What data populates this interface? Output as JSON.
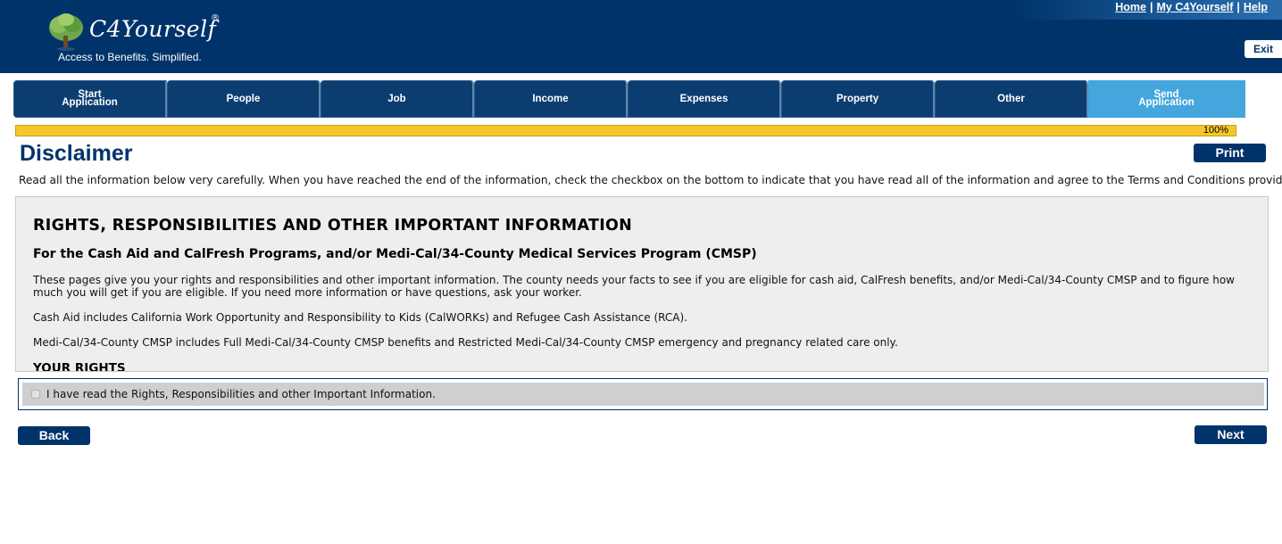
{
  "header": {
    "logo_text": "C4Yourself",
    "logo_registered": "®",
    "tagline": "Access to Benefits.  Simplified.",
    "links": [
      "Home",
      "My C4Yourself",
      "Help"
    ],
    "link_separator": "|",
    "exit_label": "Exit",
    "logo_icon": "tree-icon"
  },
  "steps": [
    {
      "label": "Start\nApplication",
      "active": false
    },
    {
      "label": "People",
      "active": false
    },
    {
      "label": "Job",
      "active": false
    },
    {
      "label": "Income",
      "active": false
    },
    {
      "label": "Expenses",
      "active": false
    },
    {
      "label": "Property",
      "active": false
    },
    {
      "label": "Other",
      "active": false
    },
    {
      "label": "Send\nApplication",
      "active": true
    }
  ],
  "progress": {
    "value": 1.0,
    "label": "100%"
  },
  "page": {
    "title": "Disclaimer",
    "print_label": "Print",
    "instructions": "Read all the information below very carefully. When you have reached the end of the information, check the checkbox on the bottom to indicate that you have read all of the information and agree to the Terms and Conditions provided."
  },
  "info": {
    "heading": "RIGHTS, RESPONSIBILITIES AND OTHER IMPORTANT INFORMATION",
    "subheading": "For the Cash Aid and CalFresh Programs, and/or Medi-Cal/34-County Medical Services Program (CMSP)",
    "para1": "These pages give you your rights and responsibilities and other important information. The county needs your facts to see if you are eligible for cash aid, CalFresh benefits, and/or Medi-Cal/34-County CMSP and to figure how much you will get if you are eligible. If you need more information or have questions, ask your worker.",
    "para2": "Cash Aid includes California Work Opportunity and Responsibility to Kids (CalWORKs) and Refugee Cash Assistance (RCA).",
    "para3": "Medi-Cal/34-County CMSP includes Full Medi-Cal/34-County CMSP benefits and Restricted Medi-Cal/34-County CMSP emergency and pregnancy related care only.",
    "rights_heading": "YOUR RIGHTS"
  },
  "agree": {
    "label": "I have read the Rights, Responsibilities and other Important Information.",
    "checked": false
  },
  "footer": {
    "back_label": "Back",
    "next_label": "Next"
  },
  "colors": {
    "brand_navy": "#00336a",
    "active_step": "#44a6dd",
    "progress": "#f7c62f"
  }
}
